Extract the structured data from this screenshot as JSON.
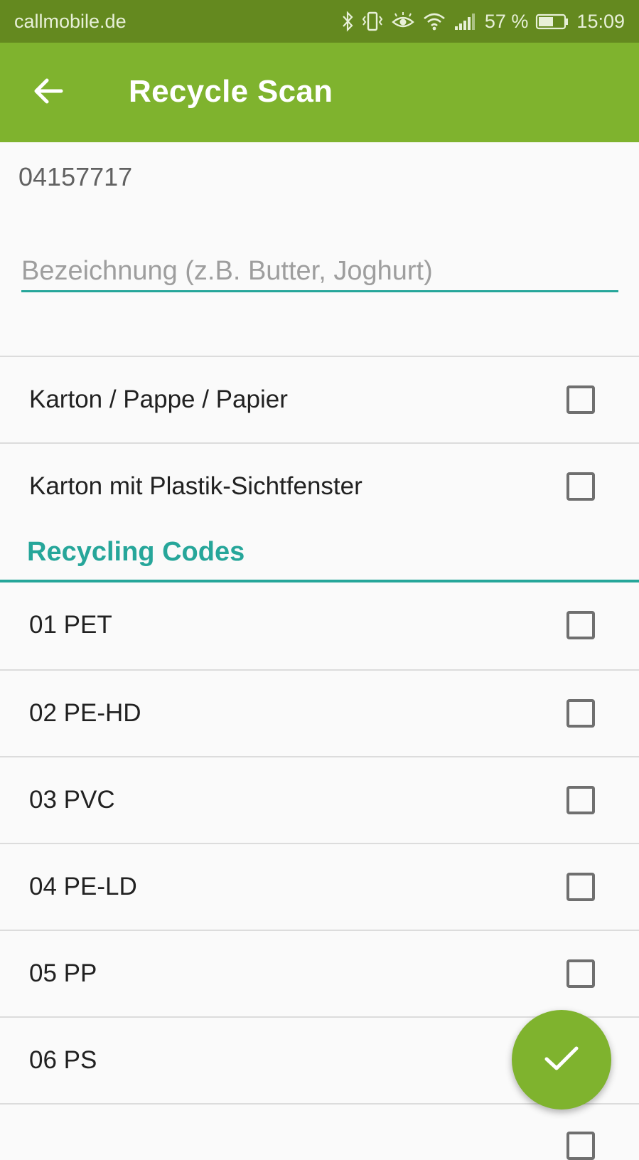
{
  "status_bar": {
    "carrier": "callmobile.de",
    "battery": "57 %",
    "time": "15:09",
    "icons": [
      "bluetooth-icon",
      "vibrate-icon",
      "eye-icon",
      "wifi-icon",
      "signal-icon",
      "battery-icon"
    ]
  },
  "app_bar": {
    "title": "Recycle Scan",
    "back_icon": "arrow-back-icon"
  },
  "barcode": "04157717",
  "name_field": {
    "placeholder": "Bezeichnung (z.B. Butter, Joghurt)",
    "value": ""
  },
  "material_items": [
    {
      "label": "Karton / Pappe / Papier",
      "checked": false
    },
    {
      "label": "Karton mit Plastik-Sichtfenster",
      "checked": false
    }
  ],
  "recycling_codes": {
    "header": "Recycling Codes",
    "items": [
      {
        "label": "01 PET",
        "checked": false
      },
      {
        "label": "02 PE-HD",
        "checked": false
      },
      {
        "label": "03 PVC",
        "checked": false
      },
      {
        "label": "04 PE-LD",
        "checked": false
      },
      {
        "label": "05 PP",
        "checked": false
      },
      {
        "label": "06 PS",
        "checked": false
      }
    ]
  },
  "fab": {
    "icon": "check-icon"
  },
  "colors": {
    "status_bar": "#64891f",
    "app_bar": "#7fb32e",
    "accent": "#26a69a",
    "fab": "#7fb32e"
  }
}
